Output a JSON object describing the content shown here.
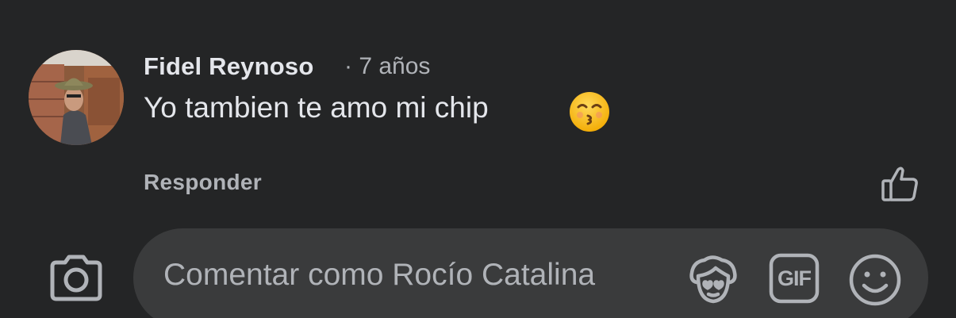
{
  "comment": {
    "author": "Fidel Reynoso",
    "meta": "· 7 años",
    "text": "Yo tambien te amo mi chip",
    "emoji": "kissing-face-with-smiling-eyes",
    "reply_label": "Responder"
  },
  "composer": {
    "placeholder": "Comentar como Rocío Catalina",
    "gif_label": "GIF"
  },
  "icons": {
    "camera": "camera-icon",
    "like": "thumbs-up-outline-icon",
    "avatar_sticker": "avatar-sticker-icon",
    "gif": "gif-icon",
    "emoji_picker": "smiley-icon"
  },
  "colors": {
    "background": "#242526",
    "input_background": "#3a3b3c",
    "primary_text": "#e4e6eb",
    "secondary_text": "#b0b3b8",
    "emoji_yellow": "#f7c233"
  }
}
